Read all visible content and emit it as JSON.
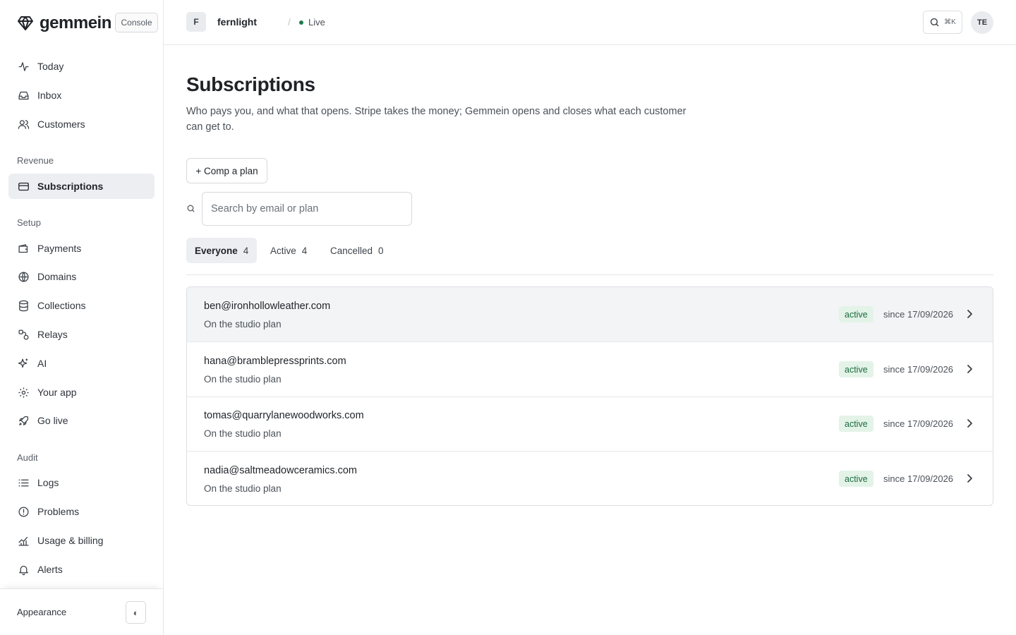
{
  "brand": {
    "name": "gemmein",
    "console_label": "Console"
  },
  "sidebar": {
    "top_items": [
      {
        "label": "Today",
        "icon": "activity-icon"
      },
      {
        "label": "Inbox",
        "icon": "inbox-icon"
      },
      {
        "label": "Customers",
        "icon": "users-icon"
      }
    ],
    "sections": [
      {
        "label": "Revenue",
        "items": [
          {
            "label": "Subscriptions",
            "icon": "credit-card-icon",
            "active": true
          }
        ]
      },
      {
        "label": "Setup",
        "items": [
          {
            "label": "Payments",
            "icon": "wallet-icon"
          },
          {
            "label": "Domains",
            "icon": "globe-icon"
          },
          {
            "label": "Collections",
            "icon": "database-icon"
          },
          {
            "label": "Relays",
            "icon": "route-icon"
          },
          {
            "label": "AI",
            "icon": "sparkles-icon"
          },
          {
            "label": "Your app",
            "icon": "gear-icon"
          },
          {
            "label": "Go live",
            "icon": "rocket-icon"
          }
        ]
      },
      {
        "label": "Audit",
        "items": [
          {
            "label": "Logs",
            "icon": "list-icon"
          },
          {
            "label": "Problems",
            "icon": "alert-circle-icon"
          },
          {
            "label": "Usage & billing",
            "icon": "chart-icon"
          },
          {
            "label": "Alerts",
            "icon": "bell-icon"
          }
        ]
      }
    ],
    "footer": {
      "appearance_label": "Appearance",
      "toggle_glyph": "◐"
    }
  },
  "topbar": {
    "org_initial": "F",
    "org_name": "fernlight",
    "separator": "/",
    "environment": "Live",
    "search_shortcut": "⌘K",
    "user_initials": "TE"
  },
  "main": {
    "title": "Subscriptions",
    "description": "Who pays you, and what that opens. Stripe takes the money; Gemmein opens and closes what each customer can get to.",
    "comp_button": "+ Comp a plan",
    "search_placeholder": "Search by email or plan",
    "tabs": [
      {
        "label": "Everyone",
        "count": "4",
        "active": true
      },
      {
        "label": "Active",
        "count": "4"
      },
      {
        "label": "Cancelled",
        "count": "0"
      }
    ],
    "subscriptions": [
      {
        "email": "ben@ironhollowleather.com",
        "plan": "On the studio plan",
        "status": "active",
        "since": "since 17/09/2026"
      },
      {
        "email": "hana@bramblepressprints.com",
        "plan": "On the studio plan",
        "status": "active",
        "since": "since 17/09/2026"
      },
      {
        "email": "tomas@quarrylanewoodworks.com",
        "plan": "On the studio plan",
        "status": "active",
        "since": "since 17/09/2026"
      },
      {
        "email": "nadia@saltmeadowceramics.com",
        "plan": "On the studio plan",
        "status": "active",
        "since": "since 17/09/2026"
      }
    ]
  },
  "colors": {
    "accent_live": "#1f7a4d",
    "status_active_bg": "#e3f3e8",
    "status_active_text": "#1c6b3f"
  }
}
